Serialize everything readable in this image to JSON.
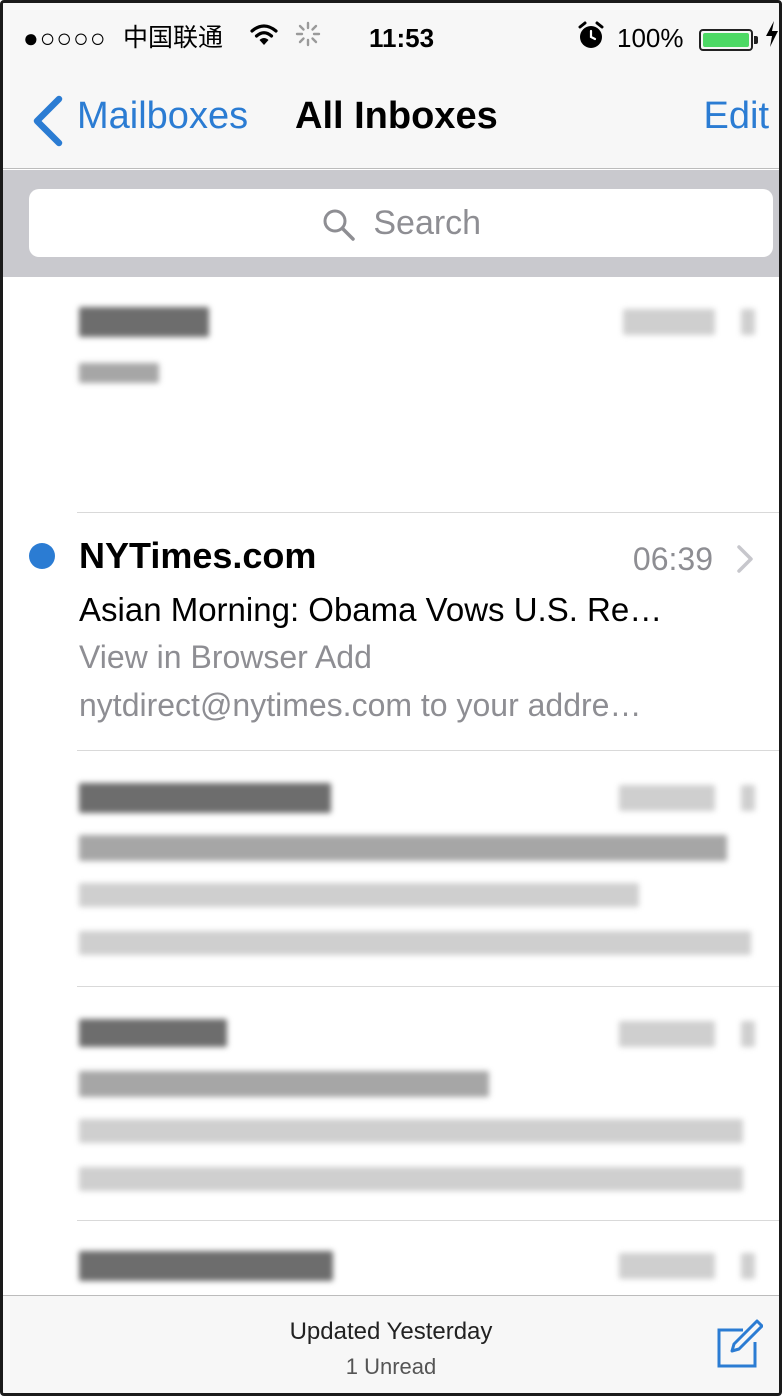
{
  "status_bar": {
    "signal": "●○○○○",
    "carrier": "中国联通",
    "wifi_icon": "wifi-icon",
    "activity_icon": "activity-spinner-icon",
    "time": "11:53",
    "alarm_icon": "alarm-icon",
    "battery_percent": "100%",
    "battery_level": 1.0,
    "charging_icon": "charging-bolt-icon"
  },
  "nav": {
    "back_label": "Mailboxes",
    "title": "All Inboxes",
    "edit_label": "Edit",
    "accent_color": "#2b7cd3"
  },
  "search": {
    "placeholder": "Search"
  },
  "messages": [
    {
      "sender": "NYTimes.com",
      "time": "06:39",
      "unread": true,
      "subject": "Asian Morning: Obama Vows U.S. Re…",
      "preview_line1": "View in Browser Add",
      "preview_line2": "nytdirect@nytimes.com to your addre…"
    }
  ],
  "toolbar": {
    "status": "Updated Yesterday",
    "unread": "1 Unread",
    "compose_icon": "compose-icon"
  }
}
